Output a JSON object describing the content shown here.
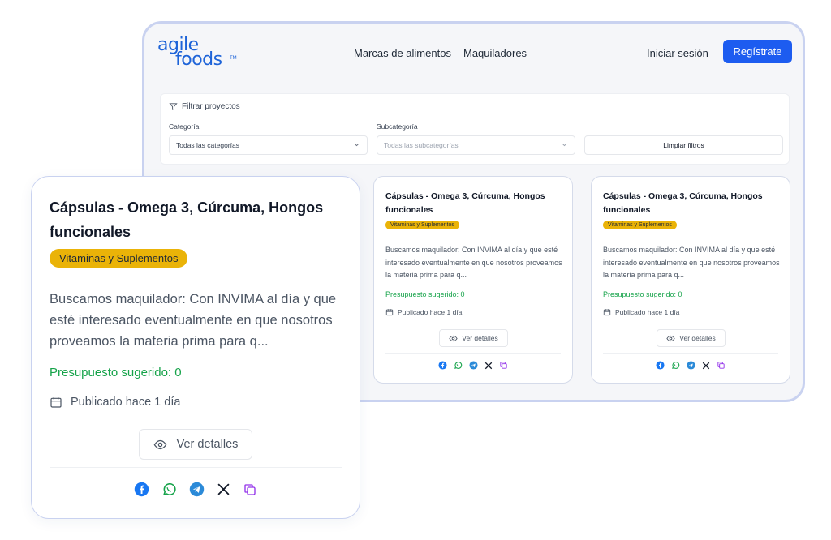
{
  "brand": {
    "line1": "agile",
    "line2": "foods",
    "tm": "TM",
    "color": "#1d63d8"
  },
  "nav": {
    "links": [
      "Marcas de alimentos",
      "Maquiladores"
    ],
    "login": "Iniciar sesión",
    "register": "Regístrate"
  },
  "filters": {
    "title": "Filtrar proyectos",
    "category_label": "Categoría",
    "category_value": "Todas las categorías",
    "subcategory_label": "Subcategoría",
    "subcategory_placeholder": "Todas las subcategorías",
    "clear": "Limpiar filtros"
  },
  "project": {
    "title": "Cápsulas - Omega 3, Cúrcuma, Hongos funcionales",
    "category_badge": "Vitaminas y Suplementos",
    "description": "Buscamos maquilador: Con INVIMA al día y que esté interesado eventualmente en que nosotros proveamos la materia prima para q...",
    "budget": "Presupuesto sugerido: 0",
    "published": "Publicado hace 1 día",
    "details": "Ver detalles"
  },
  "share_icons": [
    "facebook-icon",
    "whatsapp-icon",
    "telegram-icon",
    "x-icon",
    "copy-icon"
  ],
  "colors": {
    "primary": "#1d5cf0",
    "badge": "#eab308",
    "budget": "#16a34a",
    "facebook": "#1877f2",
    "whatsapp": "#16a34a",
    "telegram": "#2b8ad8",
    "copy": "#9333ea"
  }
}
